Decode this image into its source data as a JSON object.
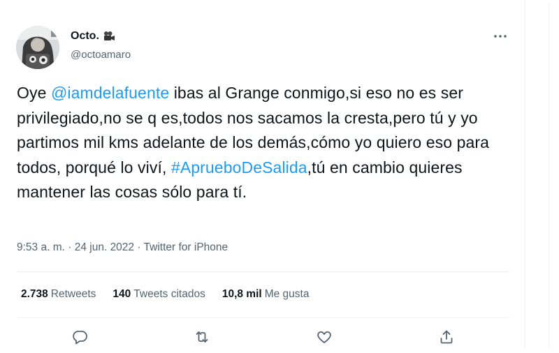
{
  "author": {
    "display_name": "Octo.",
    "handle": "@octoamaro"
  },
  "tweet": {
    "segments": [
      {
        "type": "text",
        "value": "Oye "
      },
      {
        "type": "mention",
        "value": "@iamdelafuente"
      },
      {
        "type": "text",
        "value": " ibas al Grange conmigo,si eso no es ser privilegiado,no se q es,todos nos sacamos la cresta,pero tú y yo partimos mil kms adelante de los demás,cómo yo quiero eso para todos, porqué lo viví, "
      },
      {
        "type": "hashtag",
        "value": "#AprueboDeSalida"
      },
      {
        "type": "text",
        "value": ",tú en cambio quieres mantener las cosas sólo para tí."
      }
    ]
  },
  "meta": {
    "time": "9:53 a. m.",
    "separator": " · ",
    "date": "24 jun. 2022",
    "source": "Twitter for iPhone"
  },
  "stats": {
    "retweets": {
      "count": "2.738",
      "label": "Retweets"
    },
    "quotes": {
      "count": "140",
      "label": "Tweets citados"
    },
    "likes": {
      "count": "10,8 mil",
      "label": "Me gusta"
    }
  },
  "icons": {
    "more": "more-horizontal-icon",
    "reply": "reply-icon",
    "retweet": "retweet-icon",
    "like": "heart-icon",
    "share": "share-icon",
    "name_emoji": "movie-camera-icon"
  },
  "colors": {
    "link": "#1d9bf0",
    "text": "#0f1419",
    "secondary": "#536471",
    "divider": "#eff3f4"
  }
}
